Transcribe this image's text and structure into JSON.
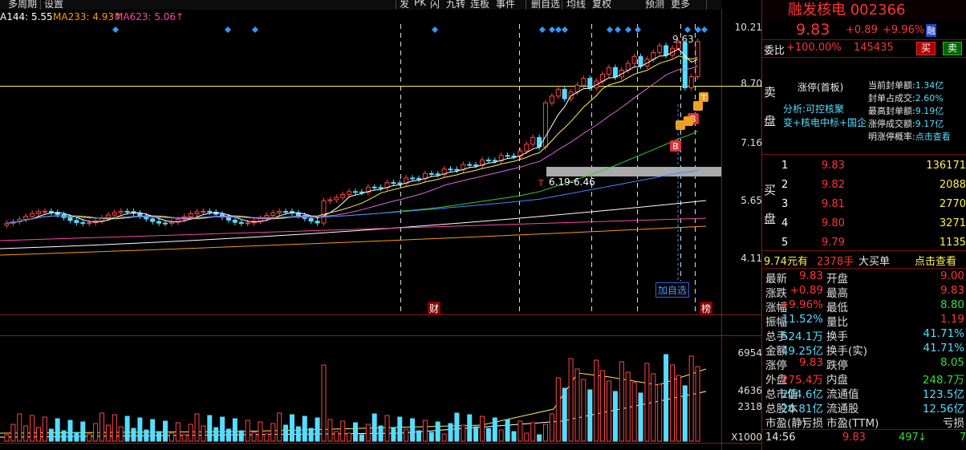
{
  "toolbar": {
    "items": [
      "多周期",
      "设置",
      "发",
      "PK",
      "闪",
      "九转",
      "连板",
      "事件",
      "删自选",
      "均线",
      "复权",
      "预测",
      "更多"
    ]
  },
  "ma_legend": {
    "ma144": "A144: 5.55",
    "ma233": "MA233: 4.93↑",
    "ma623": "MA623: 5.06↑"
  },
  "price_axis": [
    "10.21",
    "8.70",
    "7.16",
    "5.65",
    "4.11"
  ],
  "volume_axis": [
    "6954",
    "4636",
    "2318",
    "X1000"
  ],
  "annotations": {
    "high_label": "9.63",
    "gap_label": "6.19-6.46",
    "add_watch": "加自选",
    "fin_tag": "财",
    "rank_tag": "榜"
  },
  "colors": {
    "up": "#ff4444",
    "down": "#55ddff",
    "ma5": "#ffffff",
    "ma10": "#ffee55",
    "ma20": "#dd66dd",
    "ma60": "#33cc33",
    "accent_red": "#ff3333"
  },
  "stock": {
    "name_code": "融发核电 002366",
    "price": "9.83",
    "change": "+0.89",
    "pct": "+9.96%",
    "market": "融",
    "webi_label": "委比",
    "webi_value": "+100.00%",
    "webi_vol": "145435",
    "buy_btn": "买",
    "sell_btn": "卖"
  },
  "limit_info": {
    "sell_side": [
      "卖",
      "盘"
    ],
    "title": "涨停(首板)",
    "analysis": "分析:可控核聚",
    "tags": "变+核电中标+国企",
    "stats": [
      {
        "k": "当前封单额:",
        "v": "1.34亿"
      },
      {
        "k": "封单占成交:",
        "v": "2.60%"
      },
      {
        "k": "最高封单额:",
        "v": "9.19亿"
      },
      {
        "k": "涨停成交额:",
        "v": "9.17亿"
      },
      {
        "k": "明涨停概率:",
        "v": "点击查看"
      }
    ]
  },
  "buy_side": [
    "买",
    "盘"
  ],
  "order_book": [
    {
      "level": "1",
      "price": "9.83",
      "vol": "136171"
    },
    {
      "level": "2",
      "price": "9.82",
      "vol": "2088"
    },
    {
      "level": "3",
      "price": "9.81",
      "vol": "2770"
    },
    {
      "level": "4",
      "price": "9.80",
      "vol": "3271"
    },
    {
      "level": "5",
      "price": "9.79",
      "vol": "1135"
    }
  ],
  "big_order": {
    "price": "9.74元有",
    "vol": "2378手",
    "type": "大买单",
    "link": "点击查看"
  },
  "quote": [
    {
      "k1": "最新",
      "v1": "9.83",
      "k2": "开盘",
      "v2": "9.00"
    },
    {
      "k1": "涨跌",
      "v1": "+0.89",
      "k2": "最高",
      "v2": "9.83"
    },
    {
      "k1": "涨幅",
      "v1": "+9.96%",
      "k2": "最低",
      "v2": "8.80"
    },
    {
      "k1": "振幅",
      "v1": "11.52%",
      "k2": "量比",
      "v2": "1.19"
    },
    {
      "k1": "总手",
      "v1": "524.1万",
      "k2": "换手",
      "v2": "41.71%"
    },
    {
      "k1": "金额",
      "v1": "49.25亿",
      "k2": "换手(实)",
      "v2": "41.71%"
    },
    {
      "k1": "涨停",
      "v1": "9.83",
      "k2": "跌停",
      "v2": "8.05"
    },
    {
      "k1": "外盘",
      "v1": "275.4万",
      "k2": "内盘",
      "v2": "248.7万"
    },
    {
      "k1": "总市值",
      "v1": "204.6亿",
      "k2": "流通值",
      "v2": "123.5亿"
    },
    {
      "k1": "总股本",
      "v1": "20.81亿",
      "k2": "流通股",
      "v2": "12.56亿"
    },
    {
      "k1": "市盈(静)",
      "v1": "亏损",
      "k2": "市盈(TTM)",
      "v2": "亏损"
    }
  ],
  "tick": {
    "time": "14:56",
    "price": "9.83",
    "vol": "497",
    "dir": "↓",
    "extra": "7"
  }
}
